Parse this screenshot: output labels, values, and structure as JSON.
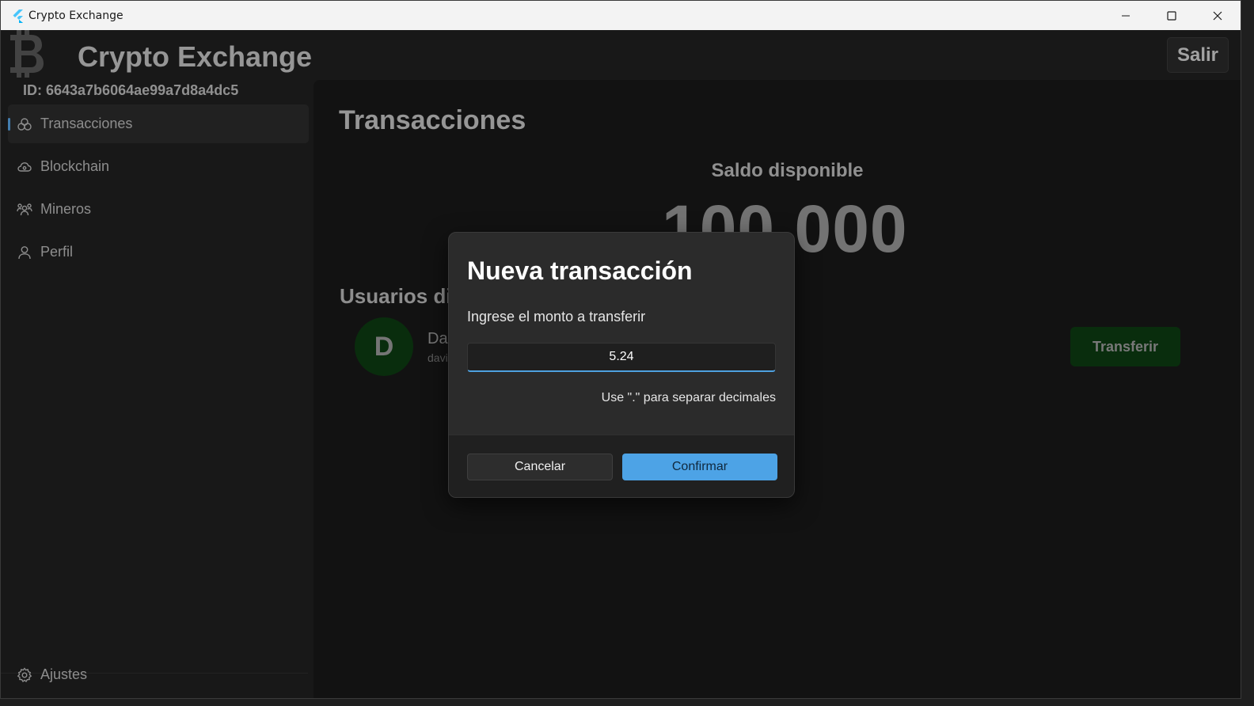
{
  "window": {
    "title": "Crypto Exchange"
  },
  "header": {
    "app_title": "Crypto Exchange",
    "user_id": "ID: 6643a7b6064ae99a7d8a4dc5",
    "logout_label": "Salir"
  },
  "sidebar": {
    "items": [
      {
        "label": "Transacciones",
        "icon": "transactions-icon",
        "active": true
      },
      {
        "label": "Blockchain",
        "icon": "cloud-icon",
        "active": false
      },
      {
        "label": "Mineros",
        "icon": "people-icon",
        "active": false
      },
      {
        "label": "Perfil",
        "icon": "person-icon",
        "active": false
      }
    ],
    "footer_item": {
      "label": "Ajustes",
      "icon": "gear-icon"
    }
  },
  "main": {
    "page_title": "Transacciones",
    "balance_label": "Saldo disponible",
    "balance_value": "100.000",
    "users_title": "Usuarios dis",
    "users": [
      {
        "initial": "D",
        "name": "Da",
        "email": "davi",
        "action_label": "Transferir"
      }
    ]
  },
  "dialog": {
    "title": "Nueva transacción",
    "prompt": "Ingrese el monto a transferir",
    "amount_value": "5.24",
    "hint": "Use \".\" para separar decimales",
    "cancel_label": "Cancelar",
    "confirm_label": "Confirmar"
  },
  "colors": {
    "accent": "#4da3e6",
    "success_bg": "#0d3d12",
    "background": "#202020"
  }
}
